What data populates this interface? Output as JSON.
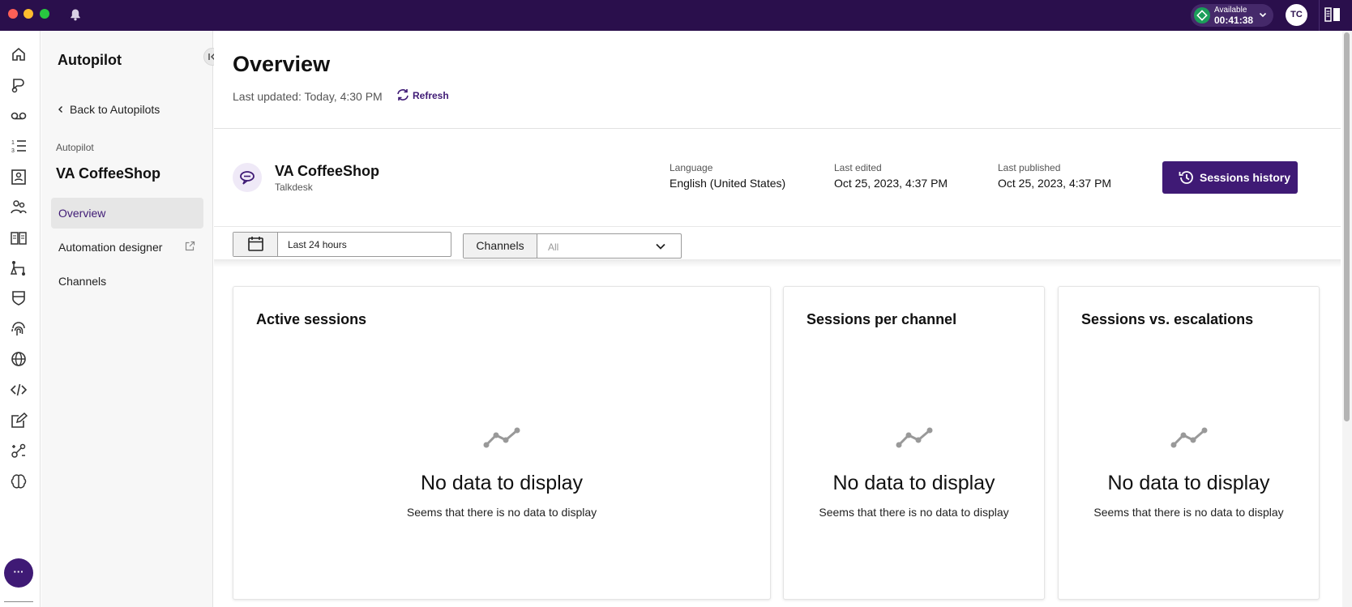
{
  "topbar": {
    "status_label": "Available",
    "status_timer": "00:41:38",
    "avatar_initials": "TC"
  },
  "sidebar": {
    "title": "Autopilot",
    "back_link": "Back to Autopilots",
    "section_label": "Autopilot",
    "autopilot_name": "VA CoffeeShop",
    "items": [
      {
        "label": "Overview",
        "active": true
      },
      {
        "label": "Automation designer",
        "external": true
      },
      {
        "label": "Channels"
      }
    ]
  },
  "rail": {
    "icons": [
      "home-icon",
      "chat-agent-icon",
      "voicemail-icon",
      "list-icon",
      "contacts-icon",
      "users-icon",
      "knowledge-book-icon",
      "flow-icon",
      "shield-icon",
      "fingerprint-icon",
      "globe-icon",
      "code-icon",
      "edit-icon",
      "integrations-icon",
      "brain-icon"
    ],
    "more_label": "···"
  },
  "header": {
    "title": "Overview",
    "last_updated": "Last updated: Today, 4:30 PM",
    "refresh_label": "Refresh"
  },
  "autopilot": {
    "name": "VA CoffeeShop",
    "owner": "Talkdesk",
    "language_label": "Language",
    "language_value": "English (United States)",
    "last_edited_label": "Last edited",
    "last_edited_value": "Oct 25, 2023, 4:37 PM",
    "last_published_label": "Last published",
    "last_published_value": "Oct 25, 2023, 4:37 PM",
    "sessions_history_label": "Sessions history"
  },
  "filters": {
    "date_range": "Last 24 hours",
    "channels_label": "Channels",
    "channels_value": "All"
  },
  "cards": [
    {
      "title": "Active sessions",
      "empty_title": "No data to display",
      "empty_message": "Seems that there is no data to display"
    },
    {
      "title": "Sessions per channel",
      "empty_title": "No data to display",
      "empty_message": "Seems that there is no data to display"
    },
    {
      "title": "Sessions vs. escalations",
      "empty_title": "No data to display",
      "empty_message": "Seems that there is no data to display"
    }
  ],
  "colors": {
    "topbar": "#2a0f4c",
    "accent": "#3f1a75",
    "available": "#1b9e5a"
  }
}
